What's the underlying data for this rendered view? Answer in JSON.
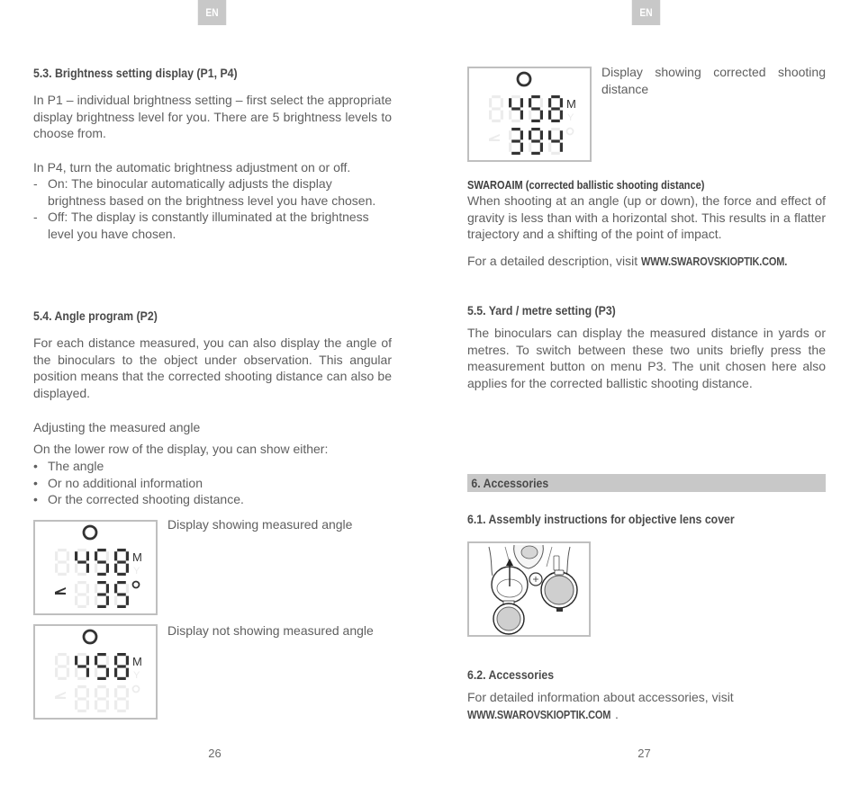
{
  "left_page": {
    "lang_tab": "EN",
    "section_5_3": {
      "heading": "5.3. Brightness setting display (P1, P4)",
      "para1": "In P1 – individual brightness setting – first select the appropriate display brightness level for you. There are 5 brightness levels to choose from.",
      "para2": "In P4, turn the automatic brightness adjustment on or off.",
      "items": [
        {
          "marker": "-",
          "text": "On: The binocular automatically adjusts the display brightness based on the brightness level you have chosen."
        },
        {
          "marker": "-",
          "text": "Off: The display is constantly illuminated at the brightness level you have chosen."
        }
      ]
    },
    "section_5_4": {
      "heading": "5.4. Angle program (P2)",
      "para1": "For each distance measured, you can also display the angle of the binoculars to the object under observation. This angular position means that the corrected shooting distance can also be displayed.",
      "subheading": "Adjusting the measured angle",
      "para2": "On the lower row of the display, you can show either:",
      "bullets": [
        {
          "marker": "•",
          "text": "The angle"
        },
        {
          "marker": "•",
          "text": "Or no additional information"
        },
        {
          "marker": "•",
          "text": "Or the corrected shooting distance."
        }
      ]
    },
    "display_angle": {
      "caption": "Display showing measured angle",
      "top_value": "458",
      "top_unit": "M",
      "top_unit_alt": "Y",
      "bottom_value": "35",
      "bottom_symbol": "°",
      "angle_icon_active": true
    },
    "display_no_angle": {
      "caption": "Display not showing measured angle",
      "top_value": "458",
      "top_unit": "M",
      "top_unit_alt": "Y",
      "bottom_value": "",
      "bottom_symbol": "°",
      "angle_icon_active": false
    },
    "page_number": "26"
  },
  "right_page": {
    "lang_tab": "EN",
    "display_corrected": {
      "caption": "Display showing corrected shooting distance",
      "top_value": "458",
      "top_unit": "M",
      "top_unit_alt": "Y",
      "bottom_value": "394",
      "bottom_symbol": "°",
      "angle_icon_active": false
    },
    "swaroaim": {
      "title": "SWAROAIM (corrected ballistic shooting distance)",
      "text": "When shooting at an angle (up or down), the force and effect of gravity is less than with a horizontal shot. This results in a flatter trajectory and a shifting of the point of impact.",
      "visit_prefix": "For a detailed description, visit ",
      "visit_link": "WWW.SWAROVSKIOPTIK.COM."
    },
    "section_5_5": {
      "heading": "5.5. Yard / metre setting (P3)",
      "text": "The binoculars can display the measured distance in yards or metres. To switch between these two units briefly press the measurement button on menu P3. The unit chosen here also applies for the corrected ballistic shooting distance."
    },
    "section_6": {
      "heading": "6. Accessories"
    },
    "section_6_1": {
      "heading": "6.1. Assembly instructions for objective lens cover",
      "image_label": "objective lens cover illustration"
    },
    "section_6_2": {
      "heading": "6.2. Accessories",
      "text": "For detailed information about accessories, visit",
      "link": "WWW.SWAROVSKIOPTIK.COM",
      "link_suffix": "."
    },
    "page_number": "27"
  },
  "colors": {
    "lcd_on": "#333333",
    "lcd_off": "#ececec",
    "tab_bg": "#c8c8c8",
    "text": "#5f5f5f"
  }
}
